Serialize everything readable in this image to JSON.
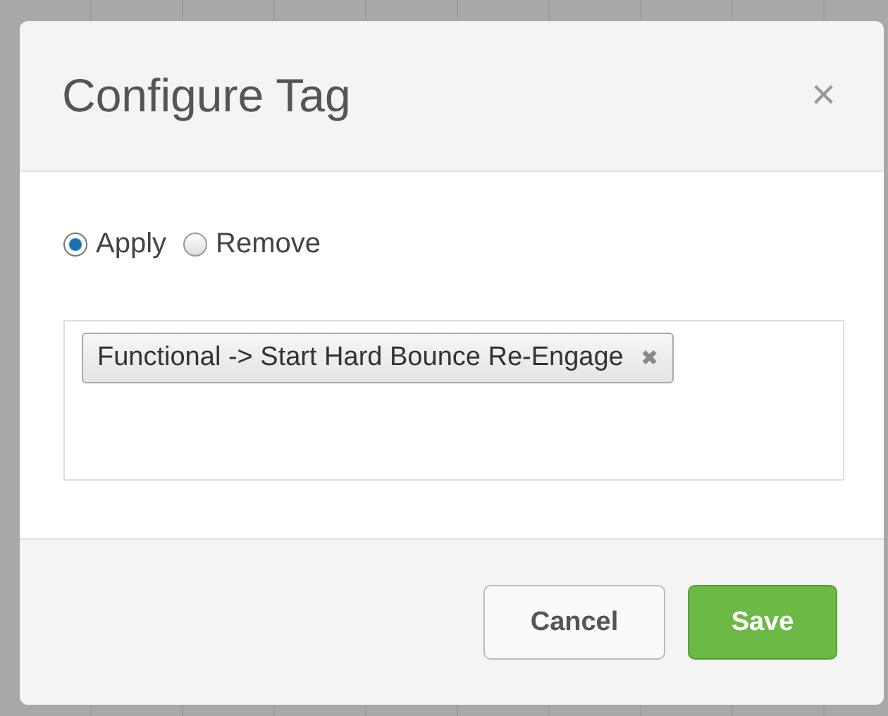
{
  "dialog": {
    "title": "Configure Tag",
    "close": "×",
    "options": [
      {
        "label": "Apply",
        "selected": true
      },
      {
        "label": "Remove",
        "selected": false
      }
    ],
    "tags": [
      {
        "label": "Functional -> Start Hard Bounce Re-Engage",
        "remove": "✖"
      }
    ],
    "buttons": [
      {
        "label": "Cancel",
        "kind": "secondary"
      },
      {
        "label": "Save",
        "kind": "primary"
      }
    ]
  }
}
